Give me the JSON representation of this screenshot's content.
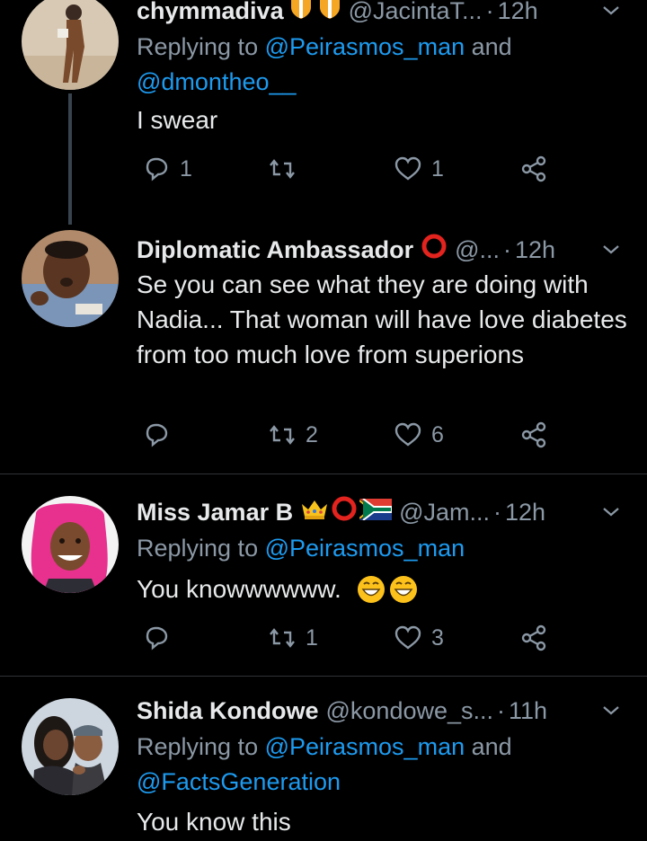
{
  "tweets": [
    {
      "name": "chymmadiva",
      "handle": "@JacintaT...",
      "time": "12h",
      "reply_prefix": "Replying to",
      "reply_mentions": "@Peirasmos_man",
      "reply_and": "and",
      "reply_mentions2": "@dmontheo__",
      "text": "I swear",
      "replies": "1",
      "retweets": "",
      "likes": "1"
    },
    {
      "name": "Diplomatic Ambassador",
      "handle": "@...",
      "time": "12h",
      "text": "Se you can see what they are doing with Nadia... That woman will have love diabetes from too much love from superions",
      "replies": "",
      "retweets": "2",
      "likes": "6"
    },
    {
      "name": "Miss Jamar B",
      "handle": "@Jam...",
      "time": "12h",
      "reply_prefix": "Replying to",
      "reply_mentions": "@Peirasmos_man",
      "text": "You knowwwwww.",
      "replies": "",
      "retweets": "1",
      "likes": "3"
    },
    {
      "name": "Shida Kondowe",
      "handle": "@kondowe_s...",
      "time": "11h",
      "reply_prefix": "Replying to",
      "reply_mentions": "@Peirasmos_man",
      "reply_and": "and",
      "reply_mentions2": "@FactsGeneration",
      "text": "You know this"
    }
  ],
  "colors": {
    "background": "#000000",
    "text": "#e7e9ea",
    "muted": "#8b98a5",
    "link": "#1d9bf0",
    "divider": "#2f3336"
  },
  "icons": [
    "reply-icon",
    "retweet-icon",
    "like-icon",
    "share-icon",
    "chevron-down-icon",
    "shield-emoji-icon",
    "red-circle-icon",
    "crown-icon",
    "south-africa-flag-icon",
    "grinning-emoji-icon"
  ]
}
